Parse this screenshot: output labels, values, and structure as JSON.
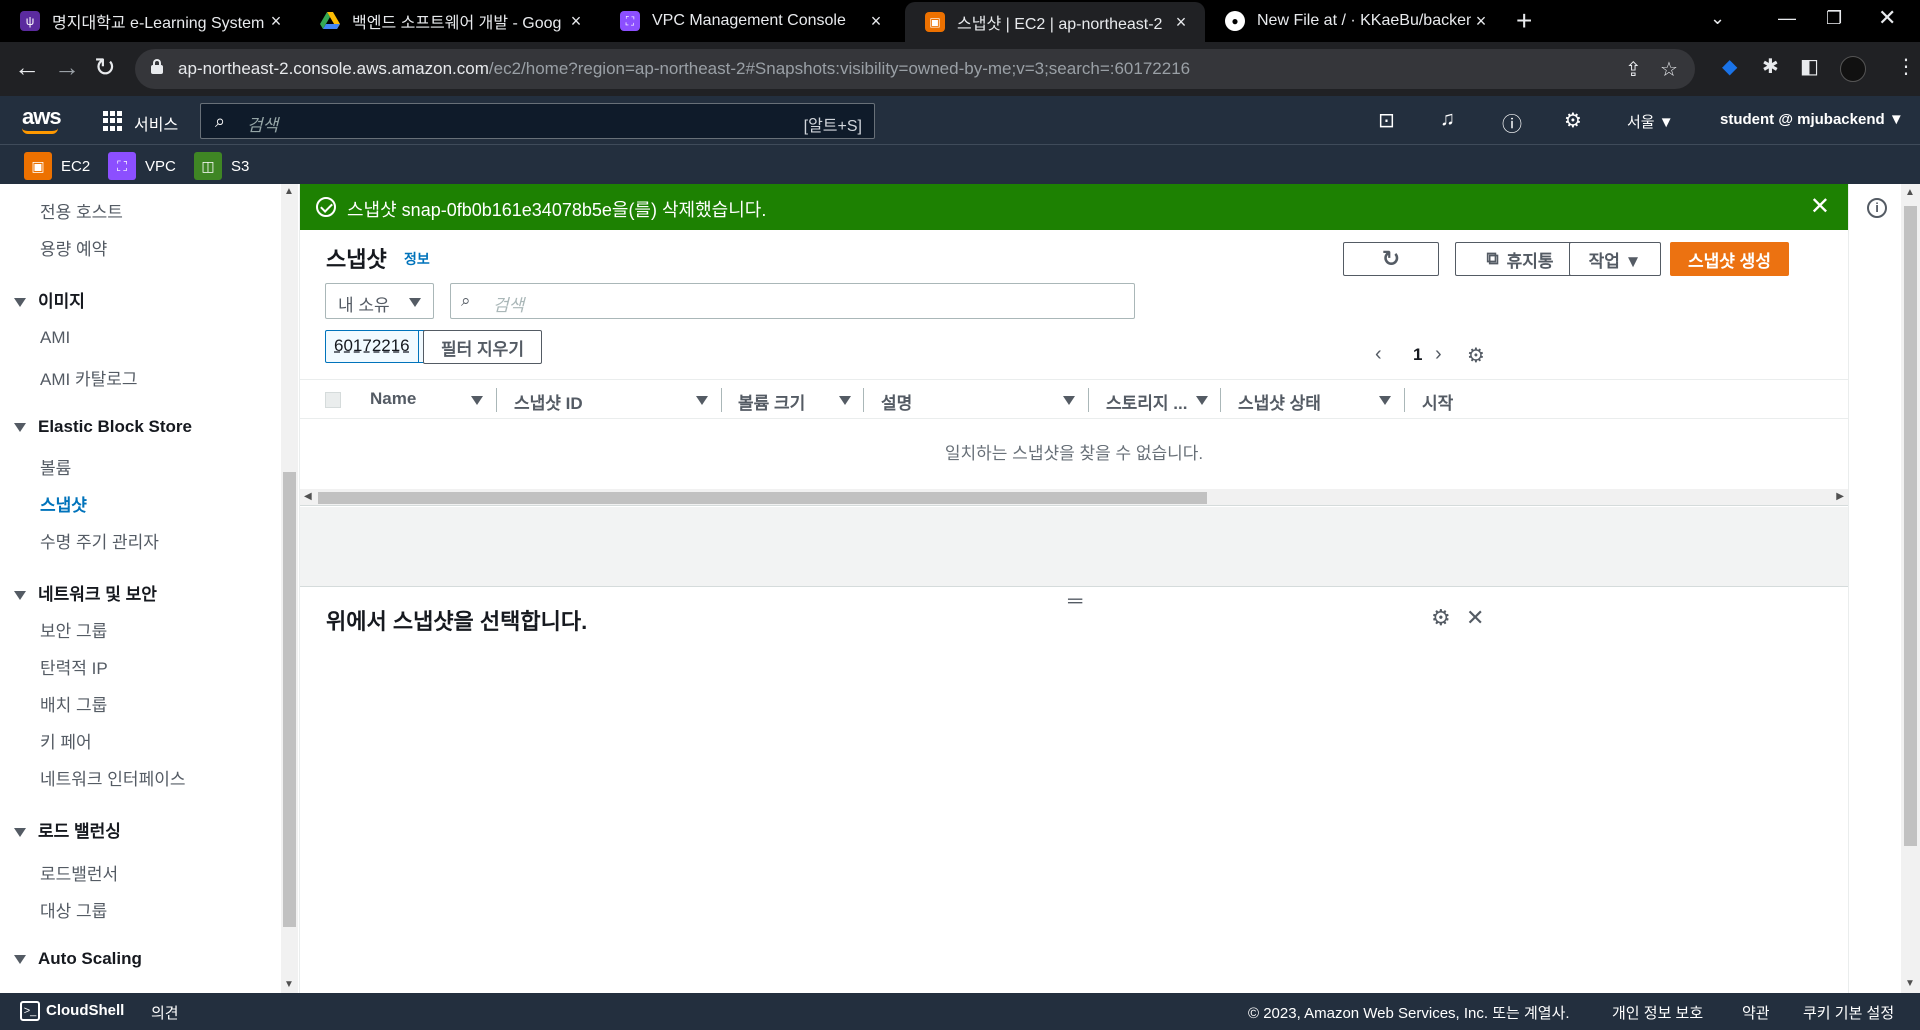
{
  "browser": {
    "tabs": [
      {
        "title": "명지대학교 e-Learning System",
        "icon": "lms-icon",
        "color": "#5b2b9e"
      },
      {
        "title": "백엔드 소프트웨어 개발 - Goog",
        "icon": "drive-icon",
        "color": "#1a73e8"
      },
      {
        "title": "VPC Management Console",
        "icon": "vpc-icon",
        "color": "#8c4fff"
      },
      {
        "title": "스냅샷 | EC2 | ap-northeast-2",
        "icon": "ec2-icon",
        "color": "#ed7100"
      },
      {
        "title": "New File at / · KKaeBu/backenc",
        "icon": "github-icon",
        "color": "#000000"
      }
    ],
    "url_host": "ap-northeast-2.console.aws.amazon.com",
    "url_path": "/ec2/home?region=ap-northeast-2#Snapshots:visibility=owned-by-me;v=3;search=:60172216"
  },
  "aws_nav": {
    "logo": "aws",
    "services_label": "서비스",
    "search_placeholder": "검색",
    "search_shortcut": "[알트+S]",
    "region": "서울 ▼",
    "user": "student @ mjubackend ▼"
  },
  "favorites": [
    {
      "label": "EC2",
      "color": "#ed7100"
    },
    {
      "label": "VPC",
      "color": "#8c4fff"
    },
    {
      "label": "S3",
      "color": "#3f8624"
    }
  ],
  "sidebar": {
    "items_top": [
      "전용 호스트",
      "용량 예약"
    ],
    "section_images": "이미지",
    "images_items": [
      "AMI",
      "AMI 카탈로그"
    ],
    "section_ebs": "Elastic Block Store",
    "ebs_items": [
      "볼륨",
      "스냅샷",
      "수명 주기 관리자"
    ],
    "section_network": "네트워크 및 보안",
    "network_items": [
      "보안 그룹",
      "탄력적 IP",
      "배치 그룹",
      "키 페어",
      "네트워크 인터페이스"
    ],
    "section_lb": "로드 밸런싱",
    "lb_items": [
      "로드밸런서",
      "대상 그룹"
    ],
    "section_as": "Auto Scaling"
  },
  "flash": {
    "message": "스냅샷 snap-0fb0b161e34078b5e을(를) 삭제했습니다.",
    "color": "#1d8102"
  },
  "main": {
    "title": "스냅샷",
    "info": "정보",
    "buttons": {
      "recycle_bin": "휴지통",
      "actions": "작업 ▼",
      "create": "스냅샷 생성"
    },
    "owner_filter": "내 소유",
    "search_placeholder": "검색",
    "filter_token": "60172216",
    "clear_filters": "필터 지우기",
    "page": "1",
    "columns": [
      "Name",
      "스냅샷 ID",
      "볼륨 크기",
      "설명",
      "스토리지 ...",
      "스냅샷 상태",
      "시작"
    ],
    "empty_message": "일치하는 스냅샷을 찾을 수 없습니다.",
    "split_title": "위에서 스냅샷을 선택합니다.",
    "accent_color": "#ec7211"
  },
  "footer": {
    "cloudshell": "CloudShell",
    "feedback": "의견",
    "copyright": "© 2023, Amazon Web Services, Inc. 또는 계열사.",
    "privacy": "개인 정보 보호",
    "terms": "약관",
    "cookies": "쿠키 기본 설정"
  }
}
